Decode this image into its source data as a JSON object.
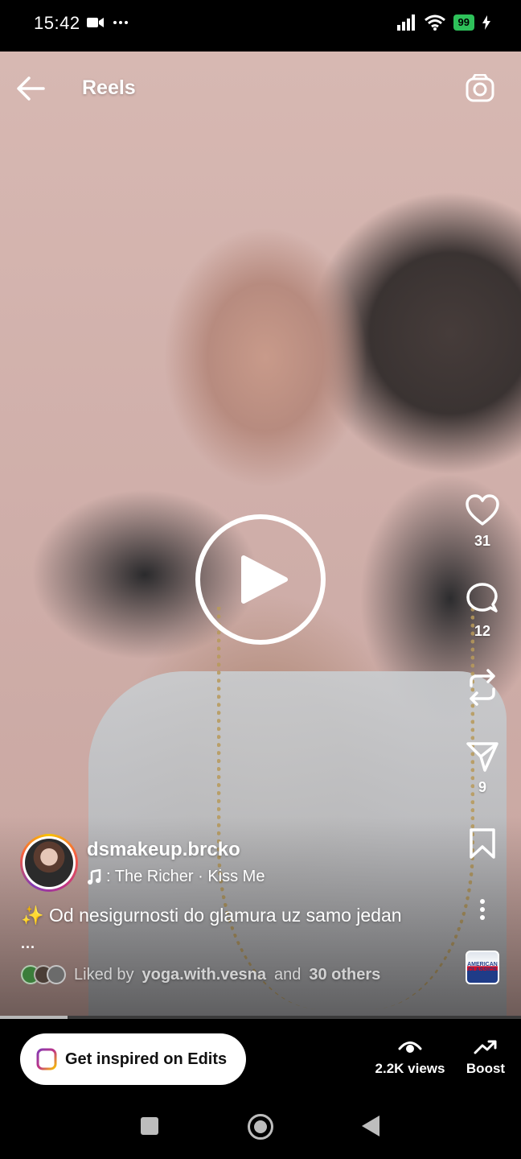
{
  "status_bar": {
    "time": "15:42",
    "left_icons": [
      "video-camera-icon",
      "more-dots-icon"
    ],
    "right_icons": [
      "signal-icon",
      "wifi-icon",
      "battery-icon",
      "charging-icon"
    ],
    "battery_level": "99"
  },
  "header": {
    "title": "Reels",
    "back_icon": "back-arrow-icon",
    "camera_icon": "camera-icon"
  },
  "player": {
    "state_icon": "play-icon",
    "progress": 0.13
  },
  "actions": {
    "likes": "31",
    "comments": "12",
    "shares": "9",
    "icons": [
      "heart-icon",
      "comment-icon",
      "repost-icon",
      "send-icon",
      "bookmark-icon",
      "more-vertical-icon"
    ]
  },
  "post": {
    "username": "dsmakeup.brcko",
    "music_icon": "music-note-icon",
    "music_text": ": The Richer · Kiss Me",
    "caption": "✨ Od nesigurnosti do glamura uz samo jedan",
    "caption_more": "...",
    "liked_prefix": "Liked by",
    "liked_user": "yoga.with.vesna",
    "liked_middle": "and",
    "liked_others": "30 others",
    "audio_thumb_text": "AMERICAN CLASSICS"
  },
  "bottom_bar": {
    "edits_label": "Get inspired on Edits",
    "edits_icon": "edits-logo-icon",
    "views_label": "2.2K views",
    "views_icon": "eye-icon",
    "boost_label": "Boost",
    "boost_icon": "trending-up-icon"
  },
  "nav_bar": {
    "icons": [
      "recents-square-icon",
      "home-circle-icon",
      "back-triangle-icon"
    ]
  },
  "colors": {
    "accent_green": "#2ec15a",
    "background": "#000000",
    "text": "#ffffff"
  }
}
